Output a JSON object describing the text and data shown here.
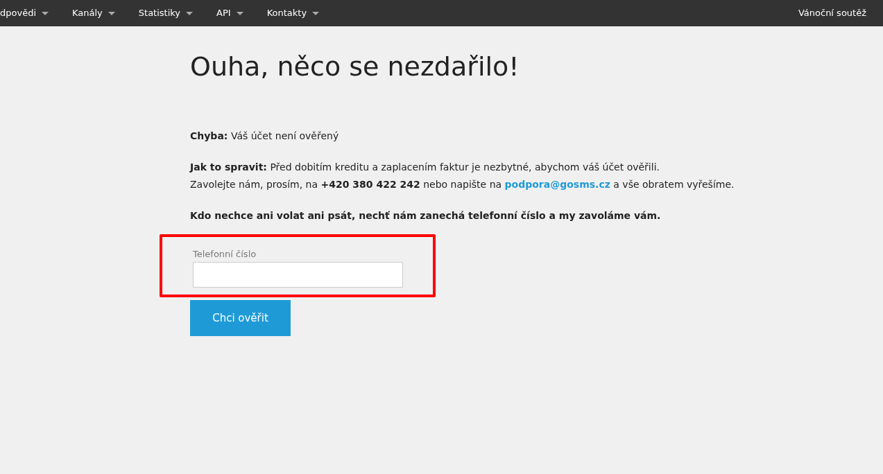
{
  "navbar": {
    "items": [
      {
        "label": "dpovědi",
        "dropdown": true
      },
      {
        "label": "Kanály",
        "dropdown": true
      },
      {
        "label": "Statistiky",
        "dropdown": true
      },
      {
        "label": "API",
        "dropdown": true
      },
      {
        "label": "Kontakty",
        "dropdown": true
      }
    ],
    "right_link": "Vánoční soutěž"
  },
  "heading": "Ouha, něco se nezdařilo!",
  "error_line": "**Chyba:** Váš účet není ověřený",
  "fix": {
    "line_1": "**Jak to spravit:** Před dobitím kreditu a zaplacením faktur je nezbytné, abychom váš účet ověřili.",
    "line_2_before": "Zavolejte nám, prosím, na **+420 380 422 242** nebo napište na",
    "email_link": "podpora@gosms.cz",
    "line_2_after": "a vše obratem vyřešíme."
  },
  "callback_note": "Kdo nechce ani volat ani psát, nechť nám zanechá telefonní číslo a my zavoláme vám.",
  "phone_form": {
    "label": "Telefonní číslo",
    "highlighted": true,
    "button": "Chci ověřit"
  }
}
